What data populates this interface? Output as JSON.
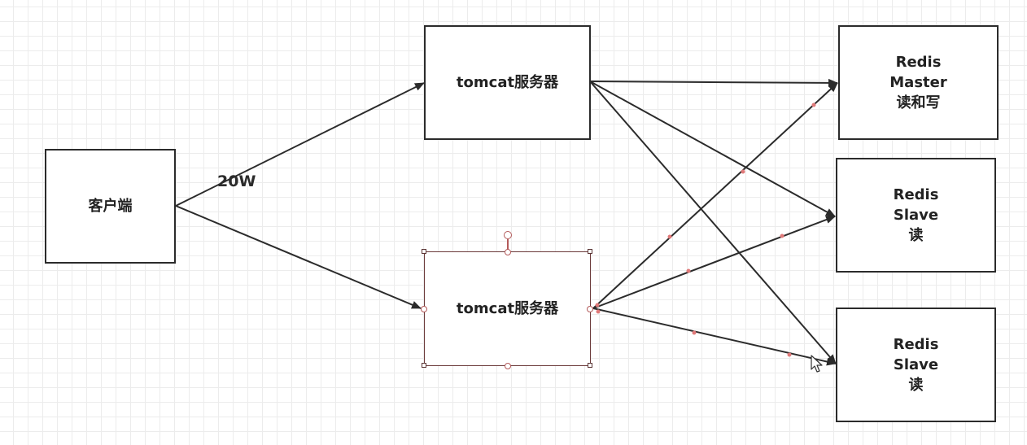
{
  "nodes": {
    "client": {
      "label": "客户端"
    },
    "tomcat_top": {
      "label": "tomcat服务器"
    },
    "tomcat_bottom": {
      "label": "tomcat服务器"
    },
    "redis_master": {
      "lines": [
        "Redis",
        "Master",
        "读和写"
      ]
    },
    "redis_slave_1": {
      "lines": [
        "Redis",
        "Slave",
        "读"
      ]
    },
    "redis_slave_2": {
      "lines": [
        "Redis",
        "Slave",
        "读"
      ]
    }
  },
  "edge_label": "20W",
  "colors": {
    "stroke": "#2b2b2b",
    "selection": "#b35a5a",
    "grid": "#ececec"
  }
}
